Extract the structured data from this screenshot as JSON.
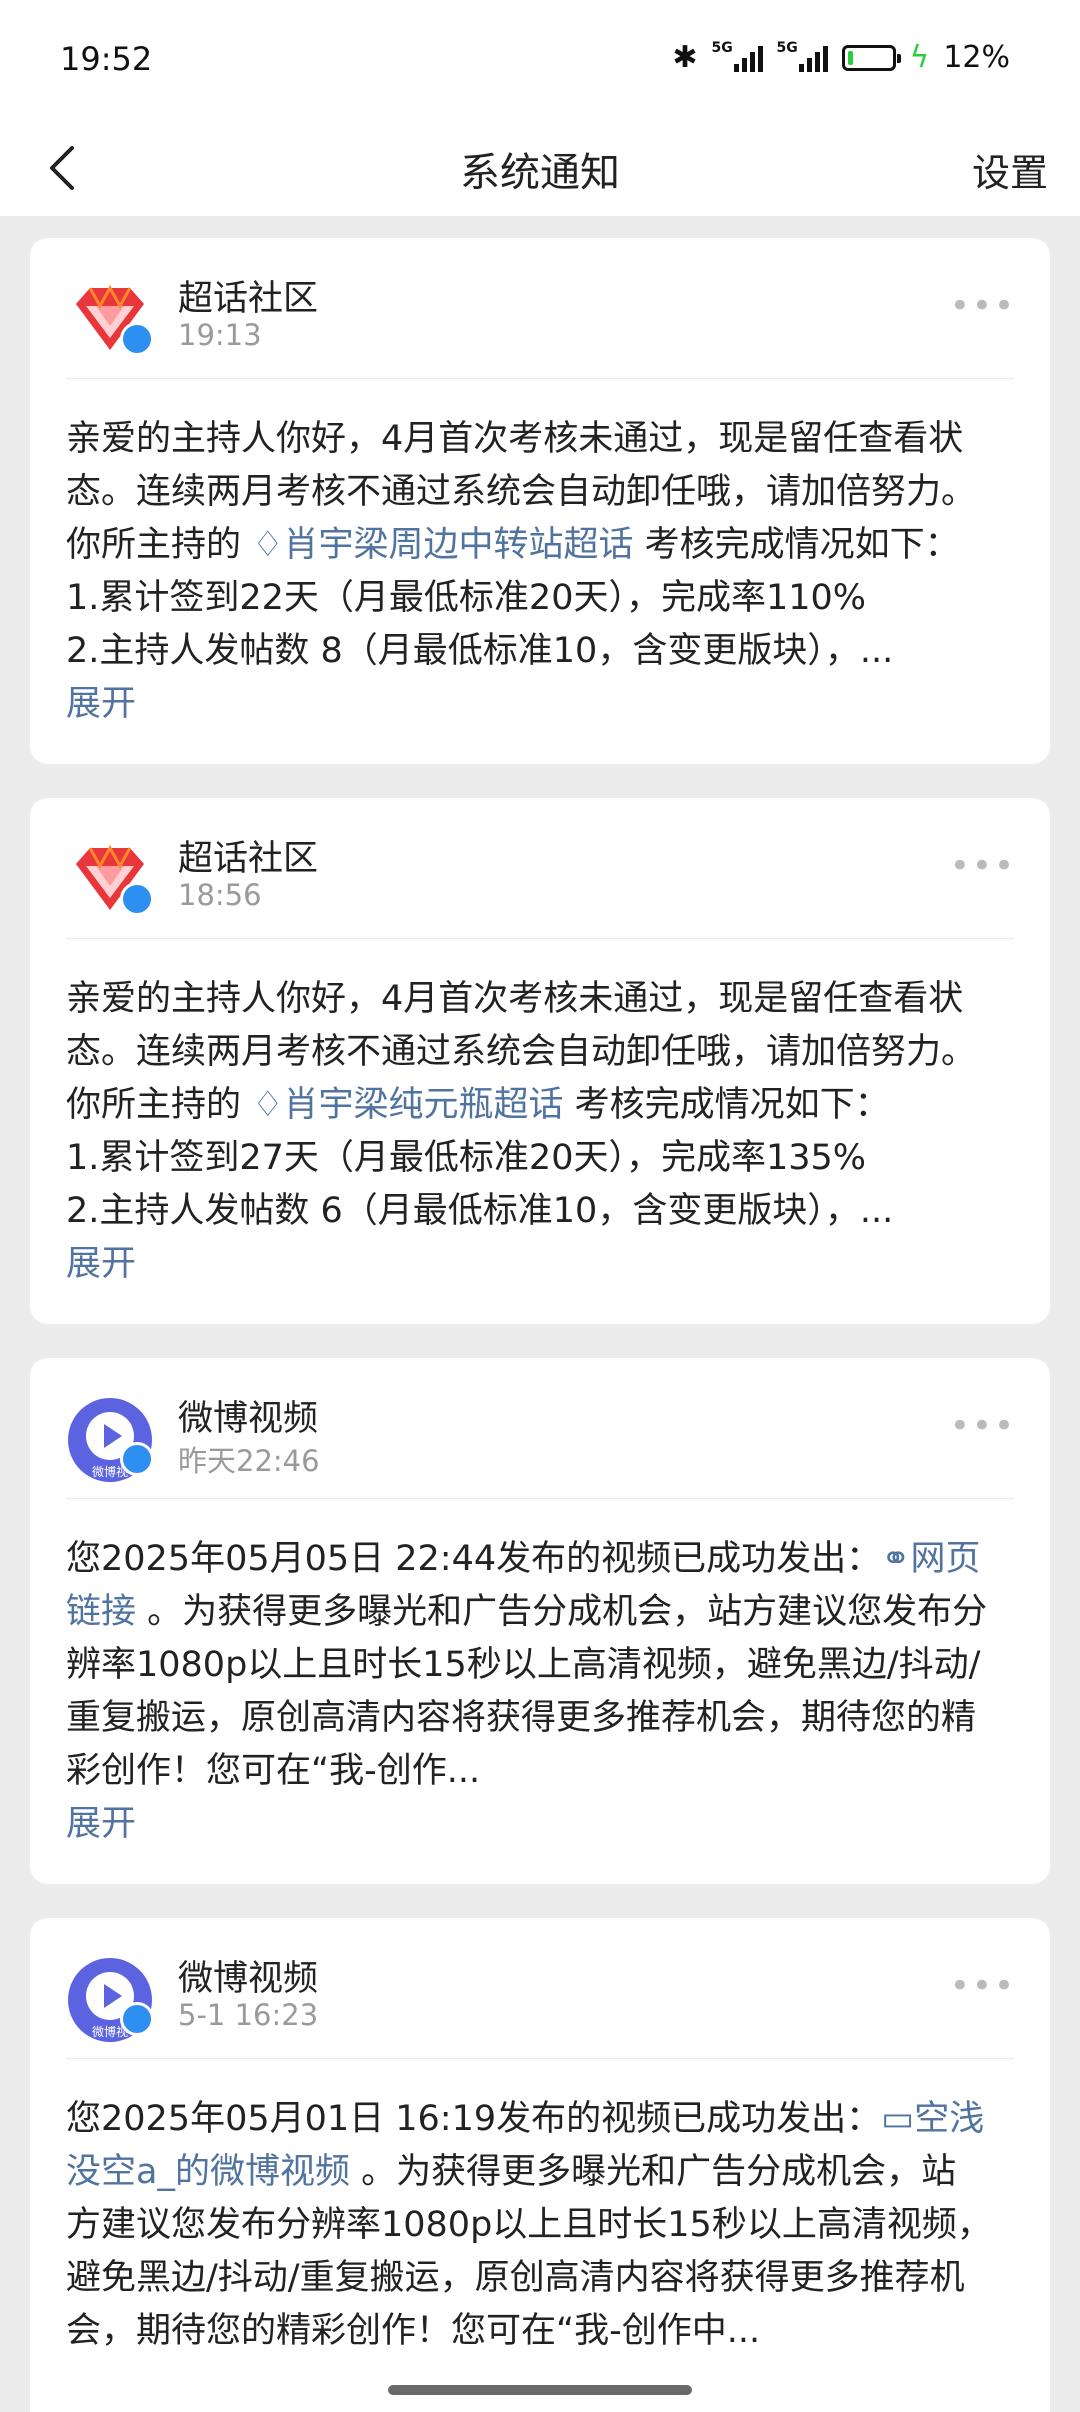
{
  "status_bar": {
    "time": "19:52",
    "net1": "5G",
    "net2": "5G",
    "battery": "12%"
  },
  "nav": {
    "title": "系统通知",
    "settings": "设置"
  },
  "cards": [
    {
      "sender": "超话社区",
      "time": "19:13",
      "l1": "亲爱的主持人你好，4月首次考核未通过，现是留任查看状",
      "l2": "态。连续两月考核不通过系统会自动卸任哦，请加倍努力。",
      "l3_pre": "你所主持的 ",
      "l3_link": "肖宇梁周边中转站超话",
      "l3_post": " 考核完成情况如下：",
      "l4": "1.累计签到22天（月最低标准20天），完成率110%",
      "l5": "2.主持人发帖数 8（月最低标准10，含变更版块），...",
      "expand": "展开"
    },
    {
      "sender": "超话社区",
      "time": "18:56",
      "l1": "亲爱的主持人你好，4月首次考核未通过，现是留任查看状",
      "l2": "态。连续两月考核不通过系统会自动卸任哦，请加倍努力。",
      "l3_pre": "你所主持的 ",
      "l3_link": "肖宇梁纯元瓶超话",
      "l3_post": " 考核完成情况如下：",
      "l4": "1.累计签到27天（月最低标准20天），完成率135%",
      "l5": "2.主持人发帖数 6（月最低标准10，含变更版块），...",
      "expand": "展开"
    },
    {
      "sender": "微博视频",
      "time": "昨天22:46",
      "avatar_text": "微博视",
      "l1_pre": "您2025年05月05日 22:44发布的视频已成功发出：",
      "l1_link": "网页",
      "l2_link": "链接",
      "l2_post": " 。为获得更多曝光和广告分成机会，站方建议您发布分",
      "l3": "辨率1080p以上且时长15秒以上高清视频，避免黑边/抖动/",
      "l4": "重复搬运，原创高清内容将获得更多推荐机会，期待您的精",
      "l5": "彩创作！您可在“我-创作...",
      "expand": "展开"
    },
    {
      "sender": "微博视频",
      "time": "5-1 16:23",
      "avatar_text": "微博视",
      "l1_pre": "您2025年05月01日 16:19发布的视频已成功发出：",
      "l1_link": "空浅",
      "l2_link": "没空a_的微博视频",
      "l2_post": " 。为获得更多曝光和广告分成机会，站",
      "l3": "方建议您发布分辨率1080p以上且时长15秒以上高清视频，",
      "l4": "避免黑边/抖动/重复搬运，原创高清内容将获得更多推荐机",
      "l5": "会，期待您的精彩创作！您可在“我-创作中..."
    }
  ]
}
